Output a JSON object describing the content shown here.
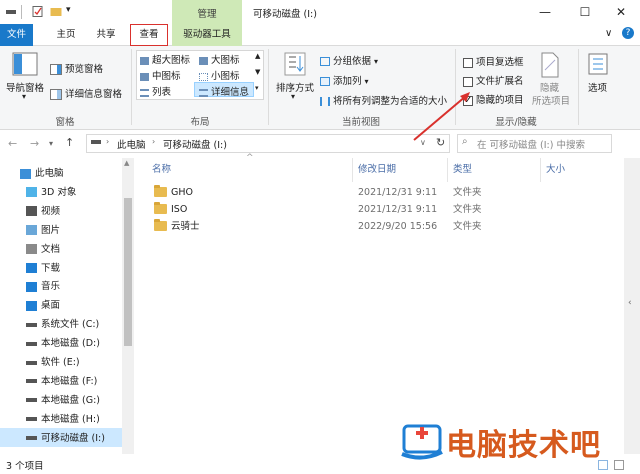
{
  "titlebar": {
    "manage_label": "管理",
    "window_title": "可移动磁盘 (I:)",
    "minimize": "—",
    "maximize": "☐",
    "close": "✕",
    "collapse_ribbon": "∨",
    "help": "?"
  },
  "tabs": {
    "file": "文件",
    "home": "主页",
    "share": "共享",
    "view": "查看",
    "drive_tools": "驱动器工具"
  },
  "ribbon": {
    "panes": {
      "nav_pane": "导航窗格",
      "preview_pane": "预览窗格",
      "details_pane": "详细信息窗格",
      "label": "窗格"
    },
    "layout": {
      "extra_large": "超大图标",
      "large": "大图标",
      "medium": "中图标",
      "small": "小图标",
      "list": "列表",
      "details": "详细信息",
      "label": "布局"
    },
    "current_view": {
      "sort_by": "排序方式",
      "group_by": "分组依据",
      "add_columns": "添加列",
      "size_all_columns": "将所有列调整为合适的大小",
      "label": "当前视图"
    },
    "show_hide": {
      "item_checkboxes": "项目复选框",
      "file_extensions": "文件扩展名",
      "hidden_items": "隐藏的项目",
      "hidden_items_checked": true,
      "hide": "隐藏",
      "hide_selected": "所选项目",
      "label": "显示/隐藏"
    },
    "options": "选项"
  },
  "address": {
    "path_pc": "此电脑",
    "path_drive": "可移动磁盘 (I:)",
    "search_placeholder": "在 可移动磁盘 (I:) 中搜索"
  },
  "nav": {
    "items": [
      {
        "label": "此电脑",
        "icon": "pc-icon"
      },
      {
        "label": "3D 对象",
        "icon": "3d-objects-icon"
      },
      {
        "label": "视频",
        "icon": "video-icon"
      },
      {
        "label": "图片",
        "icon": "pictures-icon"
      },
      {
        "label": "文档",
        "icon": "documents-icon"
      },
      {
        "label": "下载",
        "icon": "download-icon"
      },
      {
        "label": "音乐",
        "icon": "music-icon"
      },
      {
        "label": "桌面",
        "icon": "desktop-icon"
      },
      {
        "label": "系统文件 (C:)",
        "icon": "drive-icon"
      },
      {
        "label": "本地磁盘 (D:)",
        "icon": "drive-icon"
      },
      {
        "label": "软件 (E:)",
        "icon": "drive-icon"
      },
      {
        "label": "本地磁盘 (F:)",
        "icon": "drive-icon"
      },
      {
        "label": "本地磁盘 (G:)",
        "icon": "drive-icon"
      },
      {
        "label": "本地磁盘 (H:)",
        "icon": "drive-icon"
      },
      {
        "label": "可移动磁盘 (I:)",
        "icon": "usb-drive-icon"
      }
    ]
  },
  "columns": {
    "name": "名称",
    "modified": "修改日期",
    "type": "类型",
    "size": "大小"
  },
  "files": [
    {
      "name": "GHO",
      "modified": "2021/12/31 9:11",
      "type": "文件夹",
      "size": ""
    },
    {
      "name": "ISO",
      "modified": "2021/12/31 9:11",
      "type": "文件夹",
      "size": ""
    },
    {
      "name": "云骑士",
      "modified": "2022/9/20 15:56",
      "type": "文件夹",
      "size": ""
    }
  ],
  "status": {
    "count": "3 个项目"
  },
  "watermark": {
    "text": "电脑技术吧"
  },
  "colors": {
    "file_tab": "#1979ca",
    "drive_tools_band": "#cfe9b7",
    "view_tab_outline": "#d9312d",
    "folder": "#e8bb50",
    "selected_nav": "#cce8ff",
    "watermark": "#d65a1e",
    "arrow": "#d9312d"
  }
}
